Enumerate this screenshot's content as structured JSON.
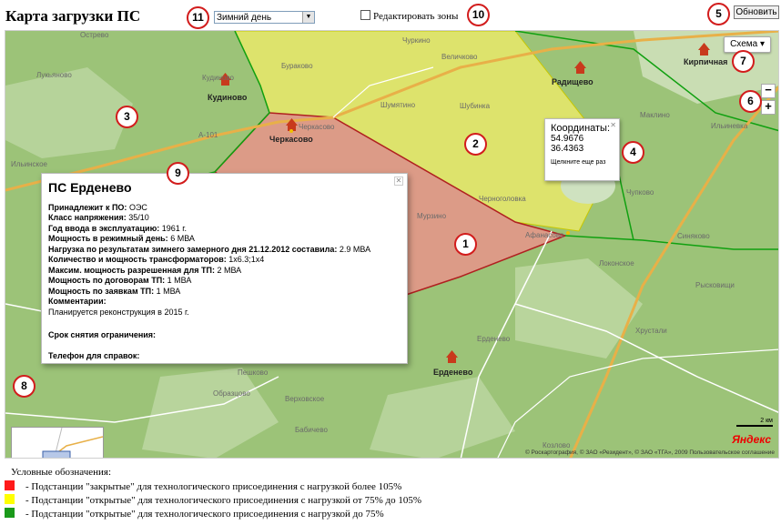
{
  "header": {
    "title": "Карта загрузки ПС",
    "season_value": "Зимний день",
    "edit_zones_label": "Редактировать зоны",
    "refresh_label": "Обновить"
  },
  "badges": [
    "1",
    "2",
    "3",
    "4",
    "5",
    "6",
    "7",
    "8",
    "9",
    "10",
    "11"
  ],
  "map": {
    "scheme_label": "Схема",
    "zoom_in": "+",
    "zoom_out": "−",
    "places": {
      "ostrevo": "Острево",
      "lukyanovo": "Лукьяново",
      "kudinovo": "Кудиново",
      "kudinovo_big": "Кудиново",
      "ilinskoe": "Ильинское",
      "cherkasovo": "Черкасово",
      "cherkasovo_big": "Черкасово",
      "burakovo": "Бураково",
      "shumyatino": "Шумятино",
      "shubinka": "Шубинка",
      "chernoglovka": "Черноголовка",
      "murzino": "Мурзино",
      "afanasovo": "Афанасово",
      "churkino": "Чуркино",
      "velichkovo": "Величково",
      "radishchevo": "Радищево",
      "kirpichnaya": "Кирпичная",
      "maklino": "Маклино",
      "ilinevka": "Ильиневка",
      "chupkovo": "Чупково",
      "lokonskoe": "Локонское",
      "sinyakovo": "Синяково",
      "ryskovishchi": "Рысковищи",
      "erdenevo": "Ерденево",
      "erdenevo_big": "Ерденево",
      "peshkovo": "Пешково",
      "obrazcovo": "Образцово",
      "verkhovskoe": "Верховское",
      "babichevo": "Бабичево",
      "khrustali": "Хрустали",
      "kozlovo": "Козлово",
      "road": "А-101"
    },
    "coord_popup": {
      "title": "Координаты:",
      "lat": "54.9676",
      "lon": "36.4363",
      "hint": "Щелкните еще раз"
    },
    "info_popup": {
      "name": "ПС Ерденево",
      "rows": [
        {
          "k": "Принадлежит к ПО:",
          "v": " ОЭС"
        },
        {
          "k": "Класс напряжения:",
          "v": " 35/10"
        },
        {
          "k": "Год ввода в эксплуатацию:",
          "v": " 1961 г."
        },
        {
          "k": "Мощность в режимный день:",
          "v": " 6 МВА"
        },
        {
          "k": "Нагрузка по результатам зимнего замерного дня 21.12.2012 составила:",
          "v": " 2.9 МВА"
        },
        {
          "k": "Количество и мощность трансформаторов:",
          "v": " 1х6.3;1х4"
        },
        {
          "k": "Максим. мощность разрешенная для ТП:",
          "v": " 2 МВА"
        },
        {
          "k": "Мощность по договорам ТП:",
          "v": " 1 МВА"
        },
        {
          "k": "Мощность по заявкам ТП:",
          "v": " 1 МВА"
        },
        {
          "k": "Комментарии:",
          "v": ""
        }
      ],
      "comment": "Планируется реконструкция в 2015 г.",
      "restriction_label": "Срок снятия ограничения:",
      "phone_label": "Телефон для справок:"
    },
    "scale_label": "2 км",
    "yandex": "Яндекс",
    "copyright": "© Роскартография, © ЗАО «Резидент», © ЗАО «ТГА», 2009 Пользовательское соглашение"
  },
  "legend": {
    "title": "Условные обозначения:",
    "items": [
      {
        "color": "#ff1a1a",
        "text": "- Подстанции \"закрытые\" для технологического присоединения с нагрузкой более 105%"
      },
      {
        "color": "#ffff00",
        "text": "- Подстанции \"открытые\" для технологического присоединения с нагрузкой от 75% до 105%"
      },
      {
        "color": "#1a9a1a",
        "text": "- Подстанции \"открытые\" для технологического присоединения с нагрузкой до 75%"
      }
    ]
  }
}
